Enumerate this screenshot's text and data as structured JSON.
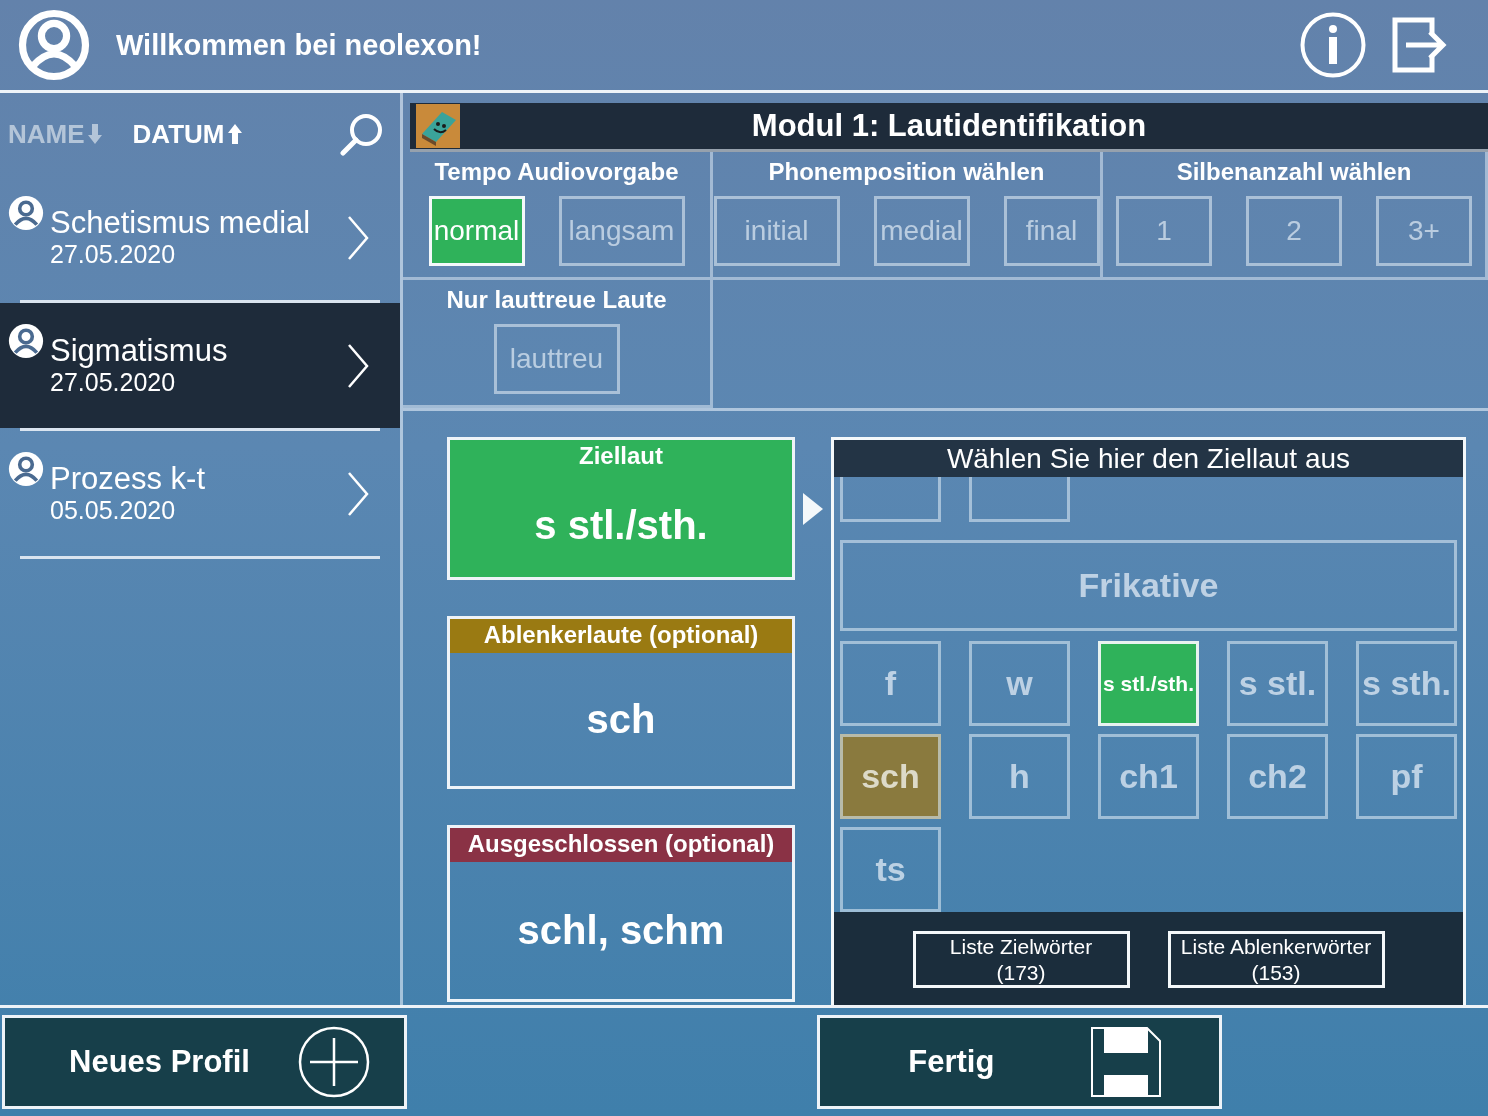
{
  "header": {
    "title": "Willkommen bei neolexon!"
  },
  "sort": [
    {
      "label": "NAME",
      "selected": false,
      "kind": "down"
    },
    {
      "label": "DATUM",
      "selected": true,
      "kind": "up"
    }
  ],
  "profiles": [
    {
      "name": "Schetismus medial",
      "date": "27.05.2020",
      "selected": false
    },
    {
      "name": "Sigmatismus",
      "date": "27.05.2020",
      "selected": true
    },
    {
      "name": "Prozess k-t",
      "date": "05.05.2020",
      "selected": false
    }
  ],
  "module": {
    "title": "Modul 1: Lautidentifikation"
  },
  "filters": [
    {
      "title": "Tempo Audiovorgabe",
      "options": [
        {
          "label": "normal",
          "selected": true
        },
        {
          "label": "langsam",
          "selected": false
        }
      ]
    },
    {
      "title": "Phonemposition wählen",
      "options": [
        {
          "label": "initial",
          "selected": false
        },
        {
          "label": "medial",
          "selected": false
        },
        {
          "label": "final",
          "selected": false
        }
      ]
    },
    {
      "title": "Silbenanzahl wählen",
      "options": [
        {
          "label": "1",
          "selected": false
        },
        {
          "label": "2",
          "selected": false
        },
        {
          "label": "3+",
          "selected": false
        }
      ]
    },
    {
      "title": "Nur lauttreue Laute",
      "options": [
        {
          "label": "lauttreu",
          "selected": false
        }
      ]
    }
  ],
  "slots": [
    {
      "kind": "target",
      "title": "Ziellaut",
      "value": "s stl./sth."
    },
    {
      "kind": "distractor",
      "title": "Ablenkerlaute (optional)",
      "value": "sch"
    },
    {
      "kind": "excluded",
      "title": "Ausgeschlossen (optional)",
      "value": "schl, schm"
    }
  ],
  "picker": {
    "title": "Wählen Sie hier den Ziellaut aus",
    "category": "Frikative",
    "sounds": [
      {
        "label": "f",
        "kind": "plain"
      },
      {
        "label": "w",
        "kind": "plain"
      },
      {
        "label": "s stl./sth.",
        "kind": "target"
      },
      {
        "label": "s stl.",
        "kind": "plain"
      },
      {
        "label": "s sth.",
        "kind": "plain"
      },
      {
        "label": "sch",
        "kind": "distractor"
      },
      {
        "label": "h",
        "kind": "plain"
      },
      {
        "label": "ch1",
        "kind": "plain"
      },
      {
        "label": "ch2",
        "kind": "plain"
      },
      {
        "label": "pf",
        "kind": "plain"
      },
      {
        "label": "ts",
        "kind": "plain"
      }
    ]
  },
  "lists": [
    {
      "label": "Liste Zielwörter",
      "count": "(173)"
    },
    {
      "label": "Liste Ablenkerwörter",
      "count": "(153)"
    }
  ],
  "footer": {
    "new_profile": "Neues Profil",
    "done": "Fertig"
  }
}
